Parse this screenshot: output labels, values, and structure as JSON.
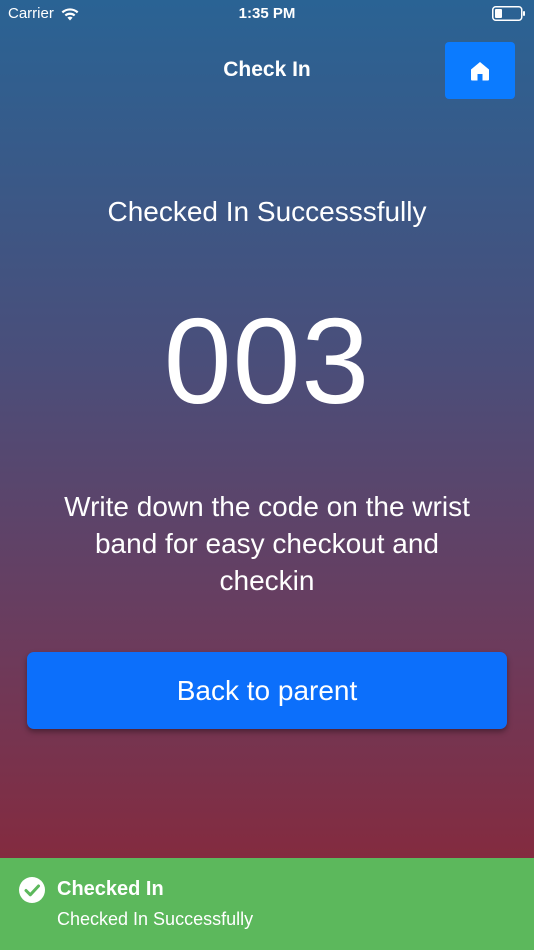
{
  "status_bar": {
    "carrier": "Carrier",
    "time": "1:35 PM",
    "wifi_icon": "wifi-icon",
    "battery_icon": "battery-icon"
  },
  "nav": {
    "title": "Check In",
    "home_icon": "home-icon"
  },
  "content": {
    "heading": "Checked In Successsfully",
    "code": "003",
    "instructions": "Write down the code on the wrist band for easy checkout and checkin",
    "back_button_label": "Back to parent"
  },
  "toast": {
    "icon": "check-circle-icon",
    "title": "Checked In",
    "message": "Checked In Successfully"
  },
  "colors": {
    "gradient_top": "#2a6394",
    "gradient_bottom": "#8e2433",
    "button_blue": "#0c6ffb",
    "toast_green": "#5cb85c"
  }
}
